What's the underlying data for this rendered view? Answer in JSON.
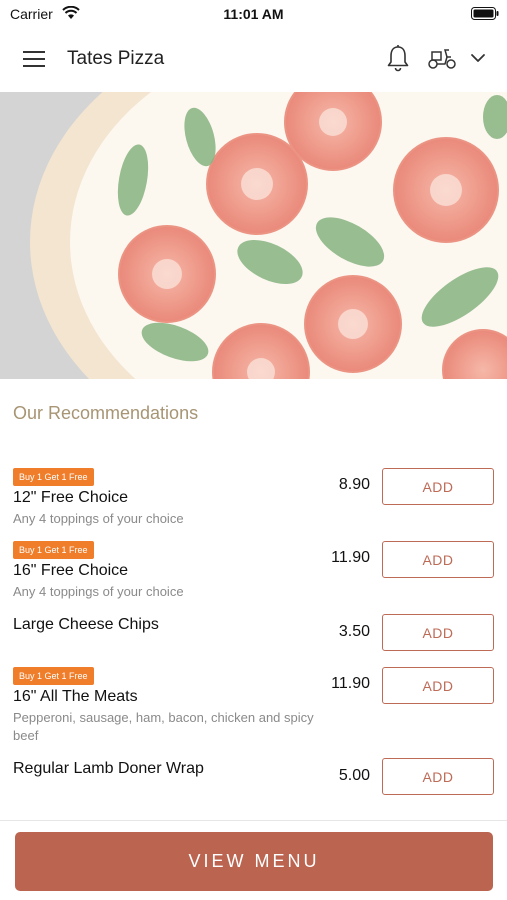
{
  "status_bar": {
    "carrier": "Carrier",
    "time": "11:01 AM"
  },
  "app_bar": {
    "title": "Tates Pizza",
    "icons": [
      "hamburger-menu-icon",
      "bell-icon",
      "scooter-icon",
      "chevron-down-icon"
    ]
  },
  "hero": {
    "image": "pizza-hero-image"
  },
  "recommendations": {
    "title": "Our Recommendations",
    "add_label": "ADD",
    "items": [
      {
        "badge": "Buy 1 Get 1 Free",
        "name": "12\" Free Choice",
        "description": "Any 4 toppings of your choice",
        "price": "8.90"
      },
      {
        "badge": "Buy 1 Get 1 Free",
        "name": "16\" Free Choice",
        "description": "Any 4 toppings of your choice",
        "price": "11.90"
      },
      {
        "badge": "",
        "name": "Large Cheese Chips",
        "description": "",
        "price": "3.50"
      },
      {
        "badge": "Buy 1 Get 1 Free",
        "name": "16\" All The Meats",
        "description": "Pepperoni, sausage, ham, bacon, chicken and spicy beef",
        "price": "11.90"
      },
      {
        "badge": "",
        "name": "Regular Lamb Doner Wrap",
        "description": "",
        "price": "5.00"
      }
    ]
  },
  "footer": {
    "view_menu_label": "VIEW MENU"
  },
  "colors": {
    "accent": "#bb6551",
    "badge": "#ef7d2a",
    "section_title": "#a79574"
  }
}
